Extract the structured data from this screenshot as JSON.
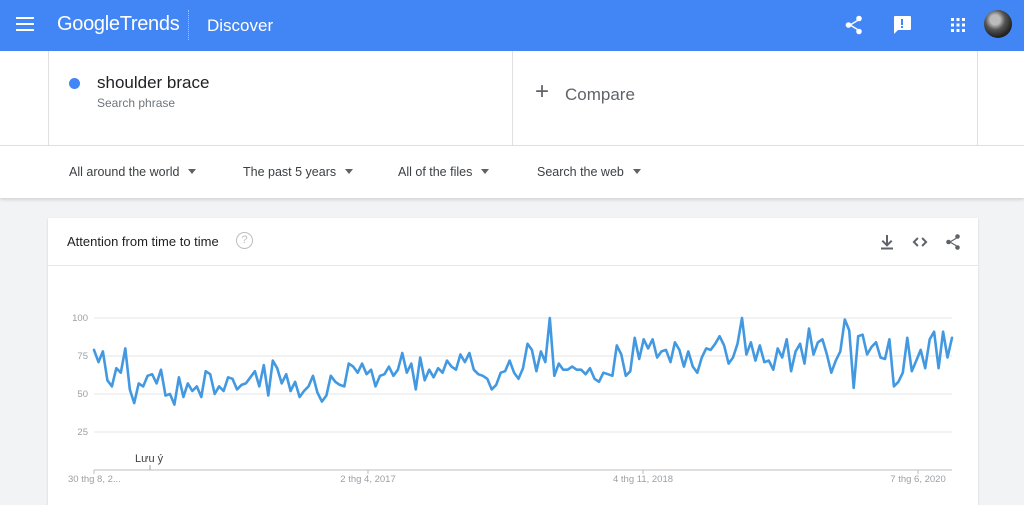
{
  "header": {
    "brand_google": "Google",
    "brand_trends": "Trends",
    "section": "Discover",
    "icons": [
      "menu-icon",
      "share-icon",
      "feedback-icon",
      "apps-grid-icon",
      "avatar"
    ]
  },
  "search": {
    "term": "shoulder brace",
    "term_type": "Search phrase",
    "term_color": "#4285f4",
    "compare_label": "Compare"
  },
  "filters": {
    "region": "All around the world",
    "time": "The past 5 years",
    "category": "All of the files",
    "property": "Search the web"
  },
  "card": {
    "title": "Attention from time to time",
    "help_symbol": "?",
    "actions": [
      "download-icon",
      "embed-code-icon",
      "share-icon"
    ]
  },
  "chart_data": {
    "type": "line",
    "series": [
      {
        "name": "shoulder brace",
        "color": "#4299e1",
        "values": [
          79,
          71,
          78,
          59,
          55,
          67,
          64,
          80,
          53,
          44,
          57,
          55,
          62,
          63,
          57,
          66,
          49,
          50,
          43,
          61,
          48,
          57,
          52,
          55,
          48,
          65,
          63,
          50,
          55,
          52,
          61,
          60,
          53,
          56,
          57,
          61,
          65,
          55,
          69,
          49,
          72,
          67,
          57,
          63,
          52,
          58,
          48,
          52,
          55,
          62,
          51,
          45,
          49,
          62,
          58,
          56,
          55,
          70,
          68,
          64,
          70,
          63,
          66,
          55,
          62,
          63,
          68,
          62,
          66,
          77,
          64,
          70,
          53,
          74,
          59,
          66,
          61,
          67,
          64,
          72,
          68,
          66,
          76,
          71,
          77,
          66,
          63,
          62,
          60,
          53,
          56,
          64,
          65,
          72,
          64,
          60,
          67,
          83,
          79,
          65,
          78,
          71,
          100,
          62,
          70,
          66,
          66,
          68,
          66,
          66,
          63,
          67,
          60,
          58,
          64,
          63,
          62,
          82,
          76,
          62,
          65,
          87,
          73,
          86,
          80,
          86,
          74,
          78,
          79,
          71,
          84,
          79,
          68,
          78,
          68,
          64,
          74,
          80,
          79,
          83,
          88,
          82,
          70,
          74,
          83,
          100,
          76,
          84,
          72,
          82,
          71,
          72,
          66,
          80,
          74,
          86,
          65,
          78,
          83,
          70,
          93,
          76,
          84,
          86,
          76,
          64,
          72,
          78,
          99,
          92,
          54,
          88,
          89,
          76,
          81,
          84,
          74,
          73,
          86,
          55,
          58,
          64,
          87,
          65,
          72,
          79,
          67,
          86,
          91,
          67,
          91,
          74,
          87
        ]
      }
    ],
    "ylim": [
      0,
      100
    ],
    "yticks": [
      "100",
      "75",
      "50",
      "25"
    ],
    "xtick_labels": [
      "30 thg 8, 2...",
      "2 thg 4, 2017",
      "4 thg 11, 2018",
      "7 thg 6, 2020"
    ],
    "annotation": "Lưu ý",
    "grid": true
  }
}
